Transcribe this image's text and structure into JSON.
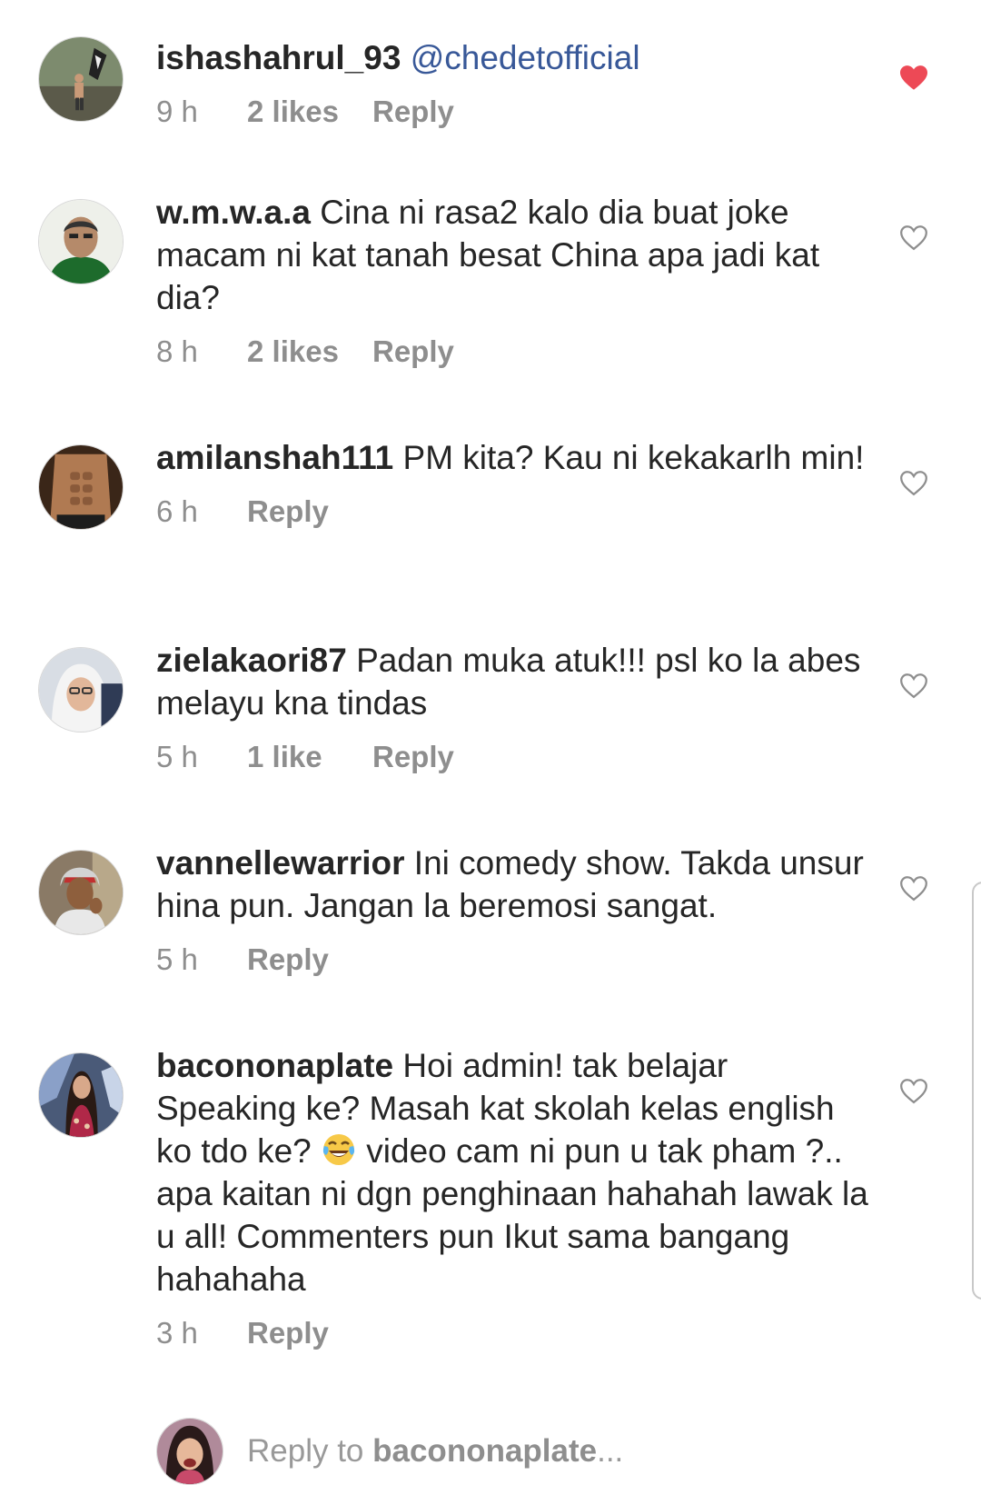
{
  "comments": [
    {
      "username": "ishashahrul_93",
      "mention": "@chedetofficial",
      "text": "",
      "time": "9 h",
      "likes": "2 likes",
      "reply": "Reply",
      "liked": true
    },
    {
      "username": "w.m.w.a.a",
      "mention": "",
      "text": "Cina ni rasa2 kalo dia buat joke macam ni kat tanah besat China apa jadi kat dia?",
      "time": "8 h",
      "likes": "2 likes",
      "reply": "Reply",
      "liked": false
    },
    {
      "username": "amilanshah111",
      "mention": "",
      "text": "PM kita? Kau ni kekakarlh min!",
      "time": "6 h",
      "likes": "",
      "reply": "Reply",
      "liked": false
    },
    {
      "username": "zielakaori87",
      "mention": "",
      "text": "Padan muka atuk!!! psl ko la abes melayu kna tindas",
      "time": "5 h",
      "likes": "1 like",
      "reply": "Reply",
      "liked": false
    },
    {
      "username": "vannellewarrior",
      "mention": "",
      "text": "Ini comedy show. Takda unsur hina pun. Jangan la beremosi sangat.",
      "time": "5 h",
      "likes": "",
      "reply": "Reply",
      "liked": false
    },
    {
      "username": "bacononaplate",
      "mention": "",
      "text_before_emoji": "Hoi admin! tak belajar Speaking ke? Masah kat skolah kelas english ko tdo ke?",
      "emoji": "face-with-tears-of-joy",
      "text_after_emoji": "video cam ni pun u tak pham ?.. apa kaitan ni dgn penghinaan hahahah lawak la u all! Commenters pun Ikut sama bangang hahahaha",
      "time": "3 h",
      "likes": "",
      "reply": "Reply",
      "liked": false
    }
  ],
  "reply_bar": {
    "prefix": "Reply to ",
    "target": "bacononaplate",
    "suffix": "..."
  },
  "colors": {
    "heart_liked": "#ed4956",
    "heart_outline": "#8e8e8e",
    "mention": "#385898",
    "meta": "#8e8e8e"
  }
}
